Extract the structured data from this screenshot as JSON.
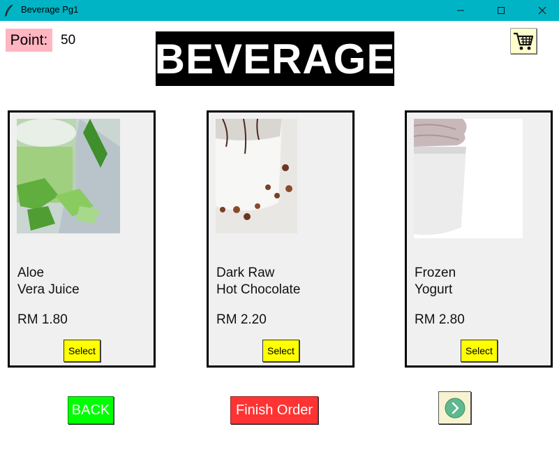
{
  "window": {
    "title": "Beverage Pg1",
    "icon": "feather-icon",
    "controls": [
      "minimize-icon",
      "maximize-icon",
      "close-icon"
    ],
    "titlebar_color": "#00b4c6"
  },
  "header": {
    "point_label": "Point:",
    "point_value": "50",
    "title": "BEVERAGE",
    "cart_icon": "cart-icon"
  },
  "products": [
    {
      "name": "Aloe\nVera Juice",
      "price": "RM 1.80",
      "select_label": "Select"
    },
    {
      "name": "Dark Raw\nHot Chocolate",
      "price": "RM 2.20",
      "select_label": "Select"
    },
    {
      "name": "Frozen\nYogurt",
      "price": "RM 2.80",
      "select_label": "Select"
    }
  ],
  "footer": {
    "back_label": "BACK",
    "finish_label": "Finish Order",
    "next_icon": "arrow-right-circle-icon"
  },
  "colors": {
    "point_bg": "#ffb6c1",
    "select_bg": "#ffff00",
    "back_bg": "#00ff00",
    "finish_bg": "#ff3333",
    "next_circle": "#5fb88f"
  }
}
